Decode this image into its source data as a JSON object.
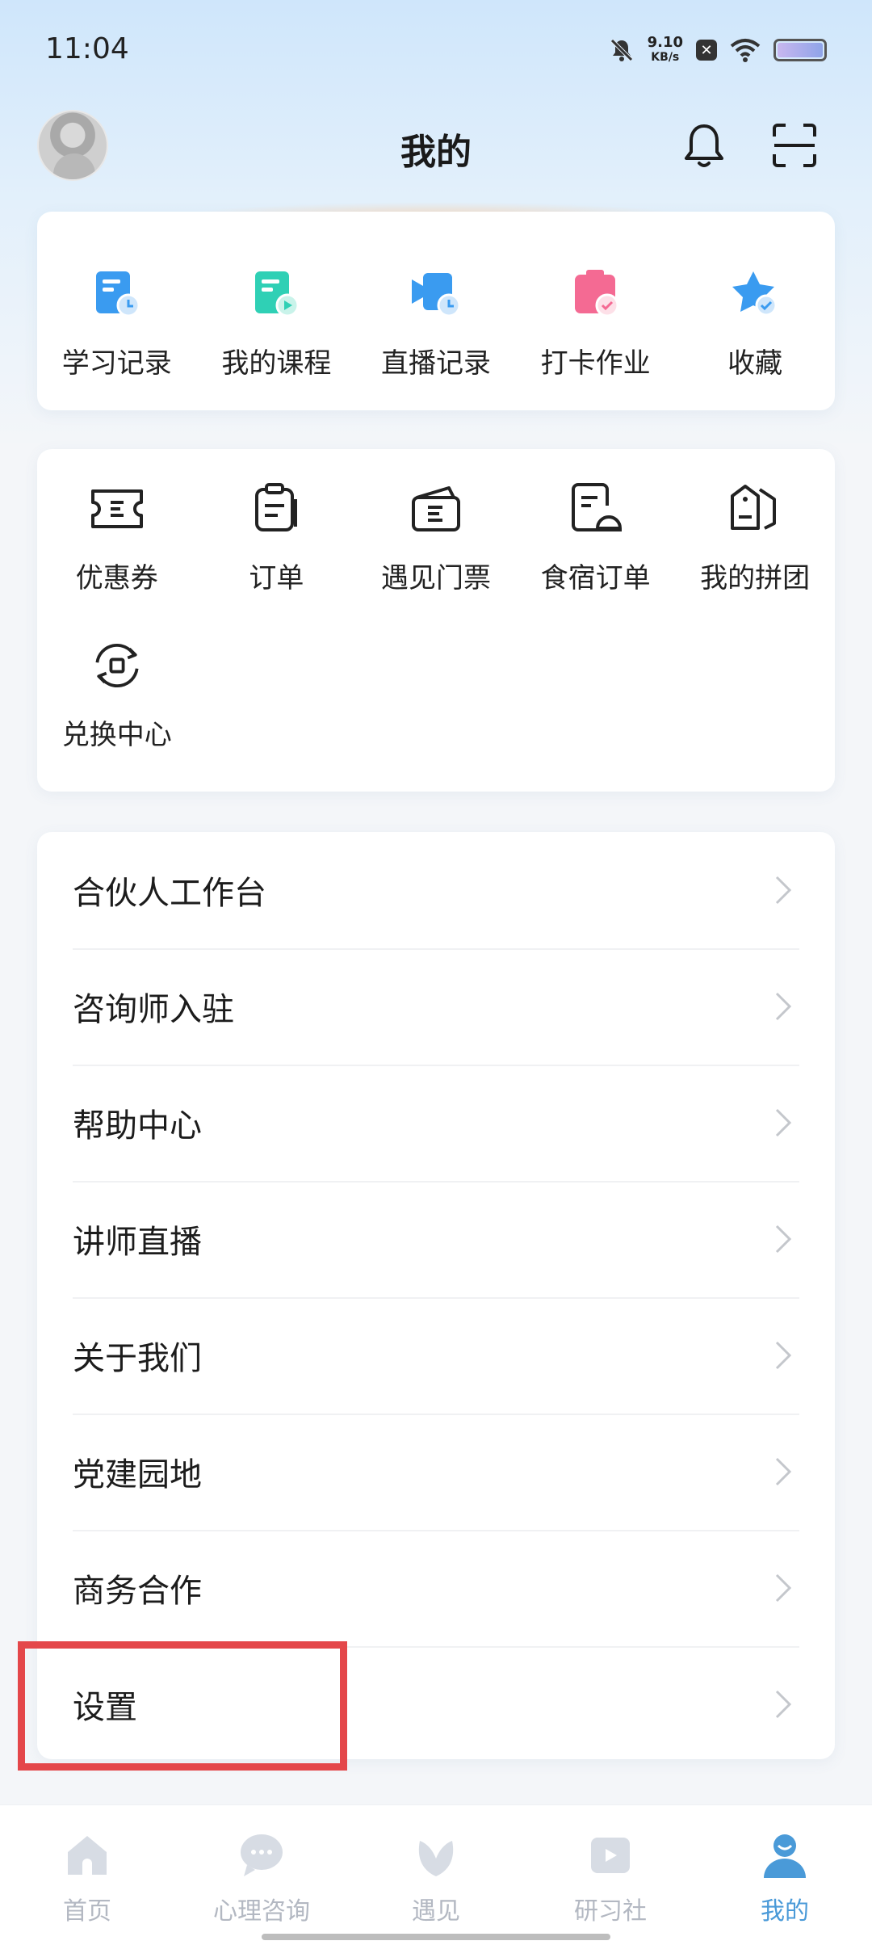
{
  "status_bar": {
    "time": "11:04",
    "net_speed": "9.10",
    "net_unit": "KB/s",
    "battery_icon": "battery-icon",
    "wifi_icon": "wifi-icon"
  },
  "header": {
    "title": "我的",
    "bell_icon": "bell-icon",
    "scan_icon": "scan-icon"
  },
  "card1": {
    "items": [
      {
        "label": "学习记录",
        "icon": "study-record-icon",
        "color": "#3a9bf0"
      },
      {
        "label": "我的课程",
        "icon": "my-course-icon",
        "color": "#2fd0b5"
      },
      {
        "label": "直播记录",
        "icon": "live-record-icon",
        "color": "#3a9bf0"
      },
      {
        "label": "打卡作业",
        "icon": "checkin-homework-icon",
        "color": "#f46a93"
      },
      {
        "label": "收藏",
        "icon": "favorite-icon",
        "color": "#3a9bf0"
      }
    ]
  },
  "card2": {
    "row1": [
      {
        "label": "优惠券",
        "icon": "coupon-icon"
      },
      {
        "label": "订单",
        "icon": "order-icon"
      },
      {
        "label": "遇见门票",
        "icon": "ticket-icon"
      },
      {
        "label": "食宿订单",
        "icon": "lodging-order-icon"
      },
      {
        "label": "我的拼团",
        "icon": "group-buy-icon"
      }
    ],
    "row2": [
      {
        "label": "兑换中心",
        "icon": "exchange-center-icon"
      }
    ]
  },
  "menu": {
    "items": [
      {
        "label": "合伙人工作台"
      },
      {
        "label": "咨询师入驻"
      },
      {
        "label": "帮助中心"
      },
      {
        "label": "讲师直播"
      },
      {
        "label": "关于我们"
      },
      {
        "label": "党建园地"
      },
      {
        "label": "商务合作"
      },
      {
        "label": "设置"
      }
    ]
  },
  "bottom_nav": {
    "items": [
      {
        "label": "首页",
        "icon": "home-icon"
      },
      {
        "label": "心理咨询",
        "icon": "consult-icon"
      },
      {
        "label": "遇见",
        "icon": "meet-icon"
      },
      {
        "label": "研习社",
        "icon": "study-club-icon"
      },
      {
        "label": "我的",
        "icon": "profile-icon",
        "active": true
      }
    ],
    "active_color": "#4a9ad8",
    "inactive_color": "#b3b8c2"
  },
  "colors": {
    "highlight": "#e4474a"
  }
}
